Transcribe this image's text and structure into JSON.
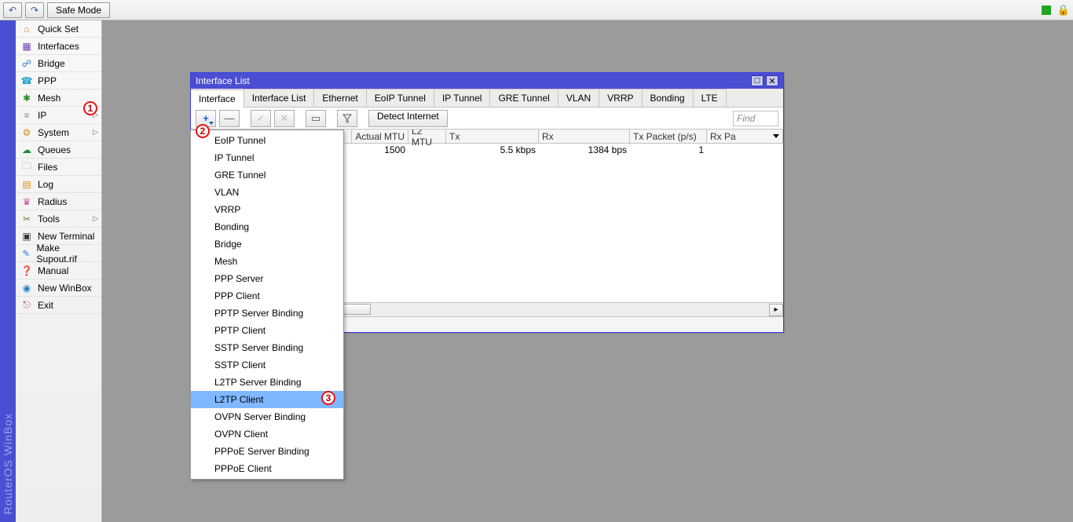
{
  "app_title": "RouterOS WinBox",
  "topbar": {
    "undo_glyph": "↶",
    "redo_glyph": "↷",
    "safe_mode": "Safe Mode",
    "lock_glyph": "🔒"
  },
  "annotations": {
    "one": "1",
    "two": "2",
    "three": "3"
  },
  "sidebar": {
    "items": [
      {
        "label": "Quick Set",
        "glyph": "⌂",
        "icls": "ic-home",
        "name": "sidebar-item-quickset"
      },
      {
        "label": "Interfaces",
        "glyph": "▦",
        "icls": "ic-if",
        "name": "sidebar-item-interfaces"
      },
      {
        "label": "Bridge",
        "glyph": "☍",
        "icls": "ic-br",
        "name": "sidebar-item-bridge"
      },
      {
        "label": "PPP",
        "glyph": "☎",
        "icls": "ic-ppp",
        "name": "sidebar-item-ppp"
      },
      {
        "label": "Mesh",
        "glyph": "✱",
        "icls": "ic-mesh",
        "name": "sidebar-item-mesh"
      },
      {
        "label": "IP",
        "glyph": "≡",
        "icls": "ic-ip",
        "name": "sidebar-item-ip",
        "submenu": true
      },
      {
        "label": "System",
        "glyph": "⚙",
        "icls": "ic-sys",
        "name": "sidebar-item-system",
        "submenu": true
      },
      {
        "label": "Queues",
        "glyph": "☁",
        "icls": "ic-q",
        "name": "sidebar-item-queues"
      },
      {
        "label": "Files",
        "glyph": "🗀",
        "icls": "ic-files",
        "name": "sidebar-item-files"
      },
      {
        "label": "Log",
        "glyph": "▤",
        "icls": "ic-log",
        "name": "sidebar-item-log"
      },
      {
        "label": "Radius",
        "glyph": "♛",
        "icls": "ic-rad",
        "name": "sidebar-item-radius"
      },
      {
        "label": "Tools",
        "glyph": "✂",
        "icls": "ic-tools",
        "name": "sidebar-item-tools",
        "submenu": true
      },
      {
        "label": "New Terminal",
        "glyph": "▣",
        "icls": "ic-term",
        "name": "sidebar-item-new-terminal"
      },
      {
        "label": "Make Supout.rif",
        "glyph": "✎",
        "icls": "ic-sup",
        "name": "sidebar-item-make-supout"
      },
      {
        "label": "Manual",
        "glyph": "❓",
        "icls": "ic-man",
        "name": "sidebar-item-manual"
      },
      {
        "label": "New WinBox",
        "glyph": "◉",
        "icls": "ic-nwb",
        "name": "sidebar-item-new-winbox"
      },
      {
        "label": "Exit",
        "glyph": "⎋",
        "icls": "ic-exit",
        "name": "sidebar-item-exit"
      }
    ]
  },
  "window": {
    "title": "Interface List",
    "tabs": [
      "Interface",
      "Interface List",
      "Ethernet",
      "EoIP Tunnel",
      "IP Tunnel",
      "GRE Tunnel",
      "VLAN",
      "VRRP",
      "Bonding",
      "LTE"
    ],
    "active_tab": 0,
    "toolbar": {
      "plus": "+",
      "minus": "—",
      "check": "✓",
      "cross": "✕",
      "note": "▭",
      "filter": "▼",
      "detect": "Detect Internet",
      "find_placeholder": "Find"
    },
    "columns": {
      "mtu": "Actual MTU",
      "l2": "L2 MTU",
      "tx": "Tx",
      "rx": "Rx",
      "txp": "Tx Packet (p/s)",
      "rxp": "Rx Pa"
    },
    "row": {
      "mtu": "1500",
      "l2": "",
      "tx": "5.5 kbps",
      "rx": "1384 bps",
      "txp": "1"
    },
    "scroll": {
      "left": "◂",
      "right": "▸"
    }
  },
  "dropdown": {
    "items": [
      "EoIP Tunnel",
      "IP Tunnel",
      "GRE Tunnel",
      "VLAN",
      "VRRP",
      "Bonding",
      "Bridge",
      "Mesh",
      "PPP Server",
      "PPP Client",
      "PPTP Server Binding",
      "PPTP Client",
      "SSTP Server Binding",
      "SSTP Client",
      "L2TP Server Binding",
      "L2TP Client",
      "OVPN Server Binding",
      "OVPN Client",
      "PPPoE Server Binding",
      "PPPoE Client"
    ],
    "highlighted_index": 15
  }
}
